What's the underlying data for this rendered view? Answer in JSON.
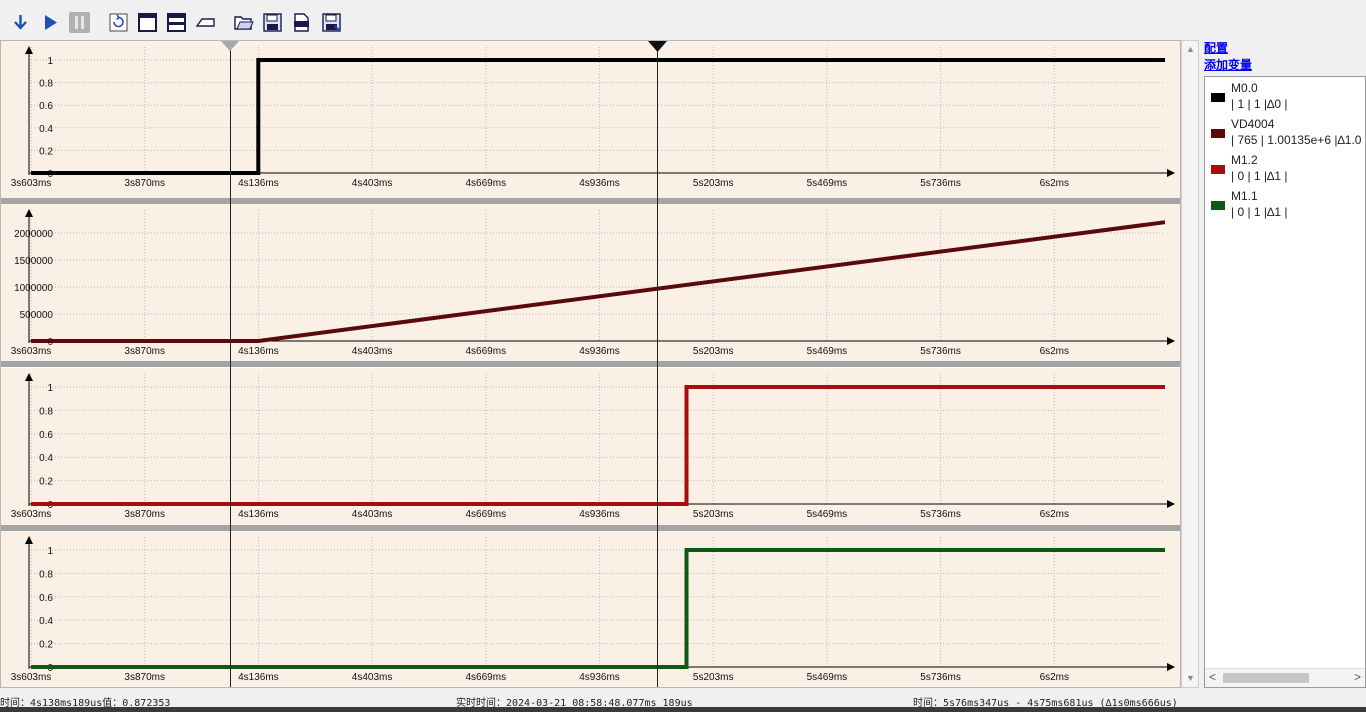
{
  "toolbar": {
    "buttons": [
      {
        "name": "download-button",
        "icon": "arrow-down-icon"
      },
      {
        "name": "play-button",
        "icon": "play-icon"
      },
      {
        "name": "pause-button",
        "icon": "pause-icon"
      },
      {
        "name": "refresh-button",
        "icon": "refresh-icon"
      },
      {
        "name": "single-window-button",
        "icon": "window-icon"
      },
      {
        "name": "split-window-button",
        "icon": "split-window-icon"
      },
      {
        "name": "erase-button",
        "icon": "eraser-icon"
      },
      {
        "name": "open-button",
        "icon": "folder-open-icon"
      },
      {
        "name": "save-button",
        "icon": "save-icon"
      },
      {
        "name": "export-csv-button",
        "icon": "csv-icon"
      },
      {
        "name": "save-as-button",
        "icon": "save-as-icon"
      }
    ]
  },
  "links": {
    "config": "配置",
    "add_variable": "添加变量"
  },
  "legend": [
    {
      "name": "M0.0",
      "stats": "| 1 | 1 |∆0 |",
      "color": "#000000"
    },
    {
      "name": "VD4004",
      "stats": "| 765 | 1.00135e+6 |∆1.0",
      "color": "#5a0a0a"
    },
    {
      "name": "M1.2",
      "stats": "| 0 | 1 |∆1 |",
      "color": "#a50e0e"
    },
    {
      "name": "M1.1",
      "stats": "| 0 | 1 |∆1 |",
      "color": "#0e5a14"
    }
  ],
  "status": {
    "cursor_time": "时间：4s138ms189us值：0.872353",
    "realtime": "实时时间：2024-03-21 08:58:48.077ms 189us",
    "measure": "时间：5s76ms347us - 4s75ms681us (∆1s0ms666us)"
  },
  "chart_data": [
    {
      "type": "line",
      "series": [
        {
          "name": "M0.0",
          "x": [
            "3s603ms",
            "4s136ms",
            "4s136ms",
            "6s2ms"
          ],
          "values": [
            0,
            0,
            1,
            1
          ]
        }
      ],
      "xticks": [
        "3s603ms",
        "3s870ms",
        "4s136ms",
        "4s403ms",
        "4s669ms",
        "4s936ms",
        "5s203ms",
        "5s469ms",
        "5s736ms",
        "6s2ms"
      ],
      "yticks": [
        "0",
        "0.2",
        "0.4",
        "0.6",
        "0.8",
        "1"
      ],
      "ylim": [
        0,
        1
      ],
      "grid": true,
      "color": "#000000"
    },
    {
      "type": "line",
      "series": [
        {
          "name": "VD4004",
          "x": [
            "3s603ms",
            "4s136ms",
            "6s2ms"
          ],
          "values": [
            0,
            0,
            2200000
          ]
        }
      ],
      "xticks": [
        "3s603ms",
        "3s870ms",
        "4s136ms",
        "4s403ms",
        "4s669ms",
        "4s936ms",
        "5s203ms",
        "5s469ms",
        "5s736ms",
        "6s2ms"
      ],
      "yticks": [
        "0",
        "500000",
        "1000000",
        "1500000",
        "2000000"
      ],
      "ylim": [
        0,
        2000000
      ],
      "grid": true,
      "color": "#5a0a0a"
    },
    {
      "type": "line",
      "series": [
        {
          "name": "M1.2",
          "x": [
            "3s603ms",
            "5s140ms",
            "5s140ms",
            "6s2ms"
          ],
          "values": [
            0,
            0,
            1,
            1
          ]
        }
      ],
      "xticks": [
        "3s603ms",
        "3s870ms",
        "4s136ms",
        "4s403ms",
        "4s669ms",
        "4s936ms",
        "5s203ms",
        "5s469ms",
        "5s736ms",
        "6s2ms"
      ],
      "yticks": [
        "0",
        "0.2",
        "0.4",
        "0.6",
        "0.8",
        "1"
      ],
      "ylim": [
        0,
        1
      ],
      "grid": true,
      "color": "#a50e0e"
    },
    {
      "type": "line",
      "series": [
        {
          "name": "M1.1",
          "x": [
            "3s603ms",
            "5s140ms",
            "5s140ms",
            "6s2ms"
          ],
          "values": [
            0,
            0,
            1,
            1
          ]
        }
      ],
      "xticks": [
        "3s603ms",
        "3s870ms",
        "4s136ms",
        "4s403ms",
        "4s669ms",
        "4s936ms",
        "5s203ms",
        "5s469ms",
        "5s736ms",
        "6s2ms"
      ],
      "yticks": [
        "0",
        "0.2",
        "0.4",
        "0.6",
        "0.8",
        "1"
      ],
      "ylim": [
        0,
        1
      ],
      "grid": true,
      "color": "#0e5a14"
    }
  ]
}
